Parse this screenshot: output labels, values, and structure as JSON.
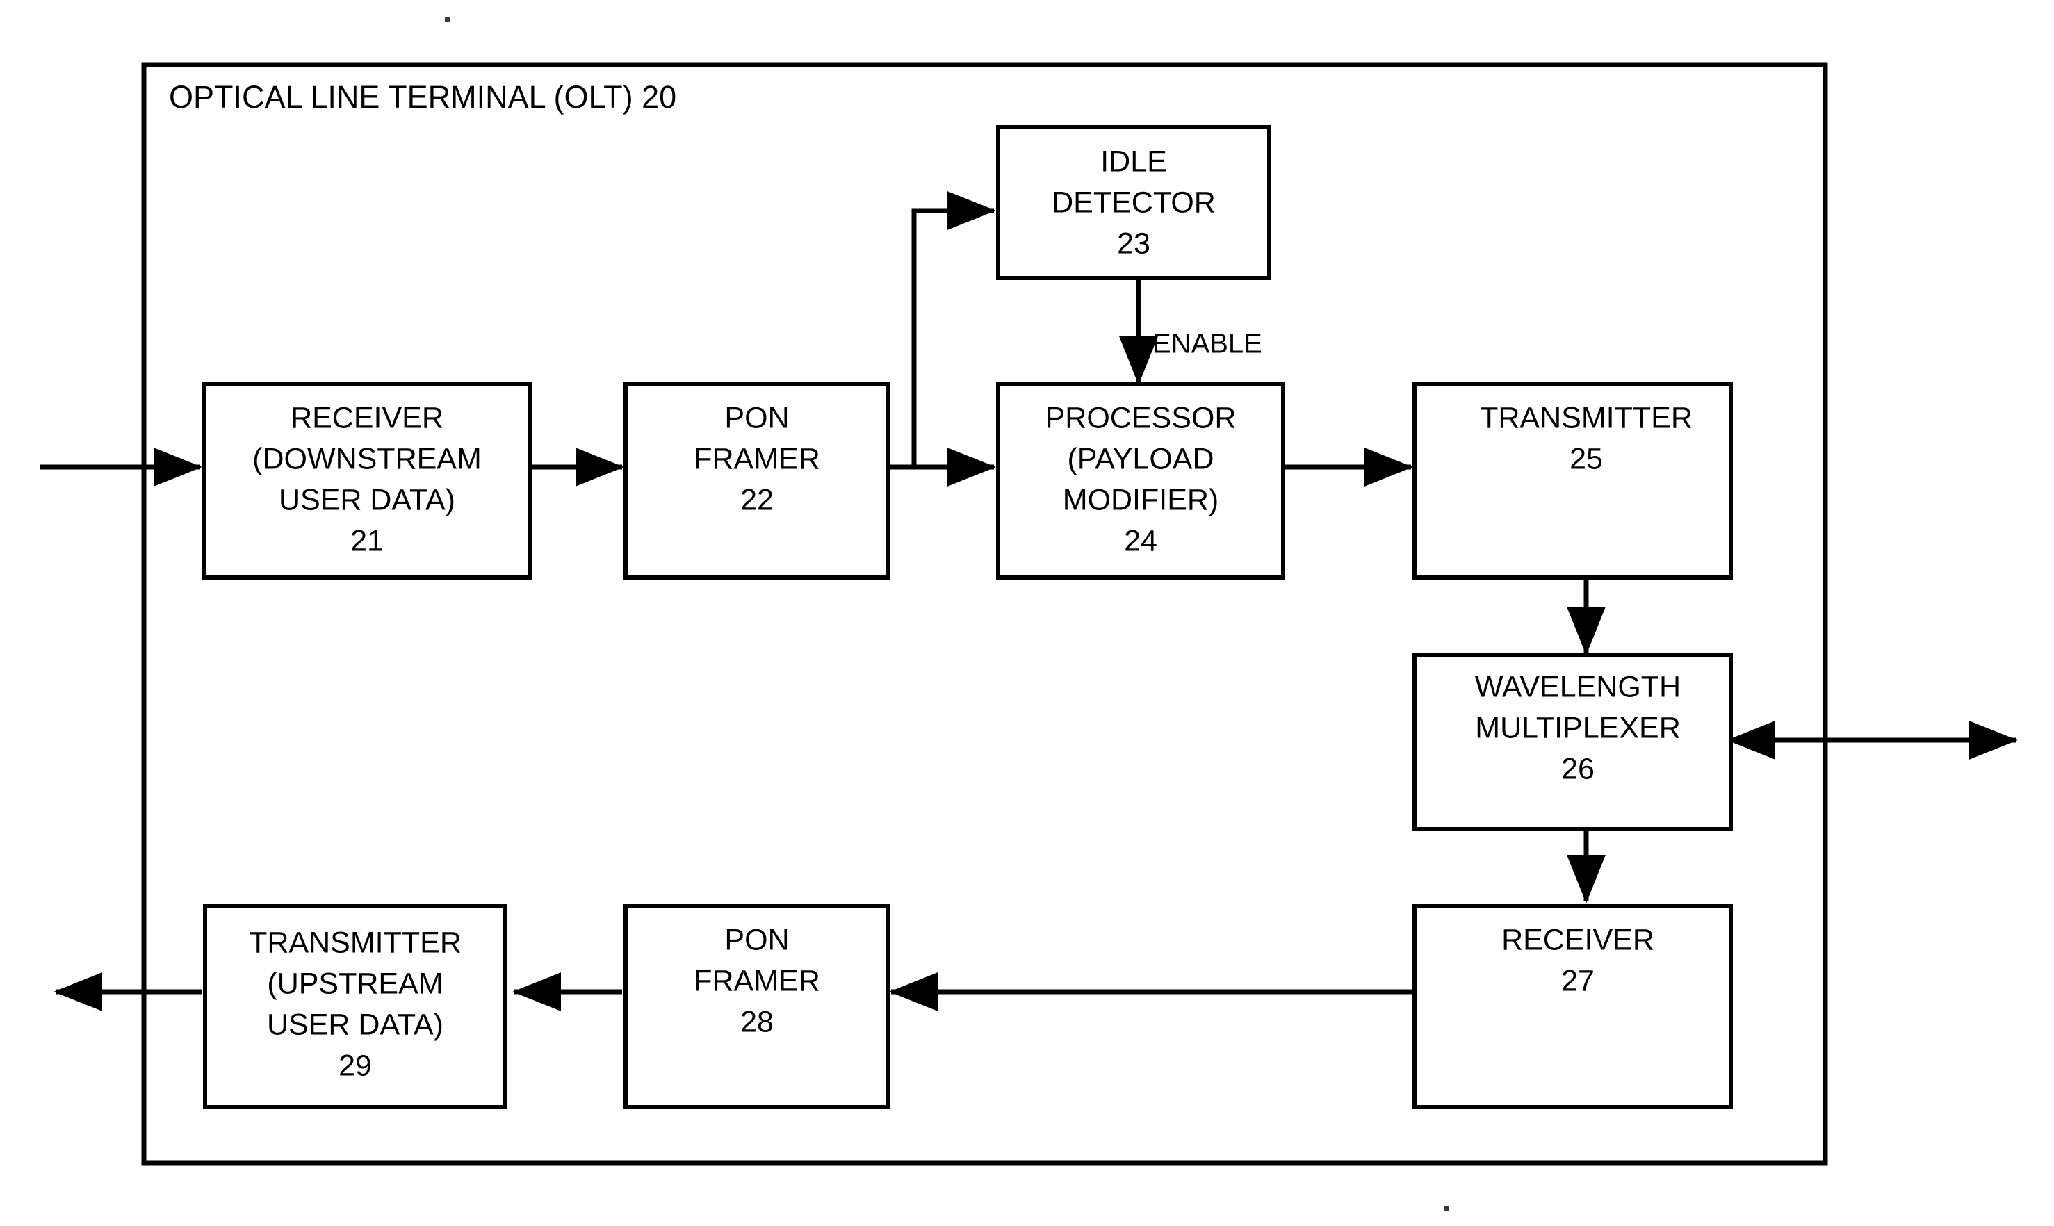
{
  "figure": {
    "type": "block-diagram",
    "outer_frame": {
      "title": "OPTICAL LINE TERMINAL (OLT) 20",
      "label_text": "OPTICAL LINE TERMINAL (OLT)",
      "reference_numeral": "20"
    },
    "blocks": [
      {
        "id": "receiver-downstream",
        "lines": [
          "RECEIVER",
          "(DOWNSTREAM",
          "USER DATA)",
          "21"
        ],
        "reference_numeral": "21",
        "name": "RECEIVER (DOWNSTREAM USER DATA)"
      },
      {
        "id": "pon-framer-22",
        "lines": [
          "PON",
          "FRAMER",
          "22"
        ],
        "reference_numeral": "22",
        "name": "PON FRAMER"
      },
      {
        "id": "idle-detector",
        "lines": [
          "IDLE",
          "DETECTOR",
          "23"
        ],
        "reference_numeral": "23",
        "name": "IDLE DETECTOR"
      },
      {
        "id": "processor-payload-modifier",
        "lines": [
          "PROCESSOR",
          "(PAYLOAD",
          "MODIFIER)",
          "24"
        ],
        "reference_numeral": "24",
        "name": "PROCESSOR (PAYLOAD MODIFIER)"
      },
      {
        "id": "transmitter-25",
        "lines": [
          "TRANSMITTER",
          "25"
        ],
        "reference_numeral": "25",
        "name": "TRANSMITTER"
      },
      {
        "id": "wavelength-multiplexer",
        "lines": [
          "WAVELENGTH",
          "MULTIPLEXER",
          "26"
        ],
        "reference_numeral": "26",
        "name": "WAVELENGTH MULTIPLEXER"
      },
      {
        "id": "receiver-27",
        "lines": [
          "RECEIVER",
          "27"
        ],
        "reference_numeral": "27",
        "name": "RECEIVER"
      },
      {
        "id": "pon-framer-28",
        "lines": [
          "PON",
          "FRAMER",
          "28"
        ],
        "reference_numeral": "28",
        "name": "PON FRAMER"
      },
      {
        "id": "transmitter-upstream",
        "lines": [
          "TRANSMITTER",
          "(UPSTREAM",
          "USER DATA)",
          "29"
        ],
        "reference_numeral": "29",
        "name": "TRANSMITTER (UPSTREAM USER DATA)"
      }
    ],
    "edge_labels": [
      {
        "id": "enable",
        "text": "ENABLE",
        "from": "idle-detector",
        "to": "processor-payload-modifier"
      }
    ],
    "connections": [
      {
        "from": "external-downstream-input",
        "to": "receiver-downstream",
        "direction": "right"
      },
      {
        "from": "receiver-downstream",
        "to": "pon-framer-22",
        "direction": "right"
      },
      {
        "from": "pon-framer-22",
        "to": "idle-detector",
        "direction": "up-right"
      },
      {
        "from": "pon-framer-22",
        "to": "processor-payload-modifier",
        "direction": "right"
      },
      {
        "from": "idle-detector",
        "to": "processor-payload-modifier",
        "direction": "down",
        "label": "ENABLE"
      },
      {
        "from": "processor-payload-modifier",
        "to": "transmitter-25",
        "direction": "right"
      },
      {
        "from": "transmitter-25",
        "to": "wavelength-multiplexer",
        "direction": "down"
      },
      {
        "from": "wavelength-multiplexer",
        "to": "external-pon-fiber",
        "direction": "bidirectional"
      },
      {
        "from": "wavelength-multiplexer",
        "to": "receiver-27",
        "direction": "down"
      },
      {
        "from": "receiver-27",
        "to": "pon-framer-28",
        "direction": "left"
      },
      {
        "from": "pon-framer-28",
        "to": "transmitter-upstream",
        "direction": "left"
      },
      {
        "from": "transmitter-upstream",
        "to": "external-upstream-output",
        "direction": "left"
      }
    ],
    "colors": {
      "stroke": "#000000",
      "background": "#ffffff",
      "text": "#000000"
    }
  }
}
